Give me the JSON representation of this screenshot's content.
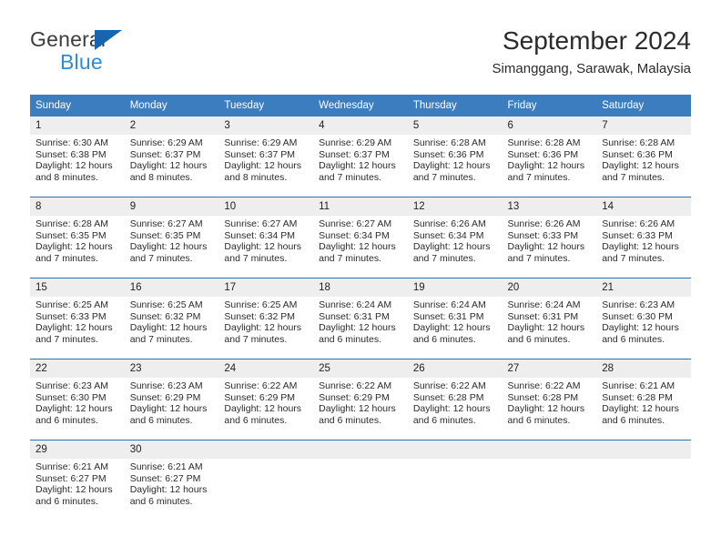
{
  "brand": {
    "name_part1": "General",
    "name_part2": "Blue",
    "triangle_color": "#1565b0",
    "blue_text_color": "#2e8bd8"
  },
  "header": {
    "title": "September 2024",
    "subtitle": "Simanggang, Sarawak, Malaysia"
  },
  "theme": {
    "header_blue": "#3b7dbf",
    "separator_blue": "#2e73ad",
    "daynum_band": "#eeeeee"
  },
  "weekday_headers": [
    "Sunday",
    "Monday",
    "Tuesday",
    "Wednesday",
    "Thursday",
    "Friday",
    "Saturday"
  ],
  "weeks": [
    {
      "days": [
        {
          "num": "1",
          "sunrise": "Sunrise: 6:30 AM",
          "sunset": "Sunset: 6:38 PM",
          "daylight_line1": "Daylight: 12 hours",
          "daylight_line2": "and 8 minutes."
        },
        {
          "num": "2",
          "sunrise": "Sunrise: 6:29 AM",
          "sunset": "Sunset: 6:37 PM",
          "daylight_line1": "Daylight: 12 hours",
          "daylight_line2": "and 8 minutes."
        },
        {
          "num": "3",
          "sunrise": "Sunrise: 6:29 AM",
          "sunset": "Sunset: 6:37 PM",
          "daylight_line1": "Daylight: 12 hours",
          "daylight_line2": "and 8 minutes."
        },
        {
          "num": "4",
          "sunrise": "Sunrise: 6:29 AM",
          "sunset": "Sunset: 6:37 PM",
          "daylight_line1": "Daylight: 12 hours",
          "daylight_line2": "and 7 minutes."
        },
        {
          "num": "5",
          "sunrise": "Sunrise: 6:28 AM",
          "sunset": "Sunset: 6:36 PM",
          "daylight_line1": "Daylight: 12 hours",
          "daylight_line2": "and 7 minutes."
        },
        {
          "num": "6",
          "sunrise": "Sunrise: 6:28 AM",
          "sunset": "Sunset: 6:36 PM",
          "daylight_line1": "Daylight: 12 hours",
          "daylight_line2": "and 7 minutes."
        },
        {
          "num": "7",
          "sunrise": "Sunrise: 6:28 AM",
          "sunset": "Sunset: 6:36 PM",
          "daylight_line1": "Daylight: 12 hours",
          "daylight_line2": "and 7 minutes."
        }
      ]
    },
    {
      "days": [
        {
          "num": "8",
          "sunrise": "Sunrise: 6:28 AM",
          "sunset": "Sunset: 6:35 PM",
          "daylight_line1": "Daylight: 12 hours",
          "daylight_line2": "and 7 minutes."
        },
        {
          "num": "9",
          "sunrise": "Sunrise: 6:27 AM",
          "sunset": "Sunset: 6:35 PM",
          "daylight_line1": "Daylight: 12 hours",
          "daylight_line2": "and 7 minutes."
        },
        {
          "num": "10",
          "sunrise": "Sunrise: 6:27 AM",
          "sunset": "Sunset: 6:34 PM",
          "daylight_line1": "Daylight: 12 hours",
          "daylight_line2": "and 7 minutes."
        },
        {
          "num": "11",
          "sunrise": "Sunrise: 6:27 AM",
          "sunset": "Sunset: 6:34 PM",
          "daylight_line1": "Daylight: 12 hours",
          "daylight_line2": "and 7 minutes."
        },
        {
          "num": "12",
          "sunrise": "Sunrise: 6:26 AM",
          "sunset": "Sunset: 6:34 PM",
          "daylight_line1": "Daylight: 12 hours",
          "daylight_line2": "and 7 minutes."
        },
        {
          "num": "13",
          "sunrise": "Sunrise: 6:26 AM",
          "sunset": "Sunset: 6:33 PM",
          "daylight_line1": "Daylight: 12 hours",
          "daylight_line2": "and 7 minutes."
        },
        {
          "num": "14",
          "sunrise": "Sunrise: 6:26 AM",
          "sunset": "Sunset: 6:33 PM",
          "daylight_line1": "Daylight: 12 hours",
          "daylight_line2": "and 7 minutes."
        }
      ]
    },
    {
      "days": [
        {
          "num": "15",
          "sunrise": "Sunrise: 6:25 AM",
          "sunset": "Sunset: 6:33 PM",
          "daylight_line1": "Daylight: 12 hours",
          "daylight_line2": "and 7 minutes."
        },
        {
          "num": "16",
          "sunrise": "Sunrise: 6:25 AM",
          "sunset": "Sunset: 6:32 PM",
          "daylight_line1": "Daylight: 12 hours",
          "daylight_line2": "and 7 minutes."
        },
        {
          "num": "17",
          "sunrise": "Sunrise: 6:25 AM",
          "sunset": "Sunset: 6:32 PM",
          "daylight_line1": "Daylight: 12 hours",
          "daylight_line2": "and 7 minutes."
        },
        {
          "num": "18",
          "sunrise": "Sunrise: 6:24 AM",
          "sunset": "Sunset: 6:31 PM",
          "daylight_line1": "Daylight: 12 hours",
          "daylight_line2": "and 6 minutes."
        },
        {
          "num": "19",
          "sunrise": "Sunrise: 6:24 AM",
          "sunset": "Sunset: 6:31 PM",
          "daylight_line1": "Daylight: 12 hours",
          "daylight_line2": "and 6 minutes."
        },
        {
          "num": "20",
          "sunrise": "Sunrise: 6:24 AM",
          "sunset": "Sunset: 6:31 PM",
          "daylight_line1": "Daylight: 12 hours",
          "daylight_line2": "and 6 minutes."
        },
        {
          "num": "21",
          "sunrise": "Sunrise: 6:23 AM",
          "sunset": "Sunset: 6:30 PM",
          "daylight_line1": "Daylight: 12 hours",
          "daylight_line2": "and 6 minutes."
        }
      ]
    },
    {
      "days": [
        {
          "num": "22",
          "sunrise": "Sunrise: 6:23 AM",
          "sunset": "Sunset: 6:30 PM",
          "daylight_line1": "Daylight: 12 hours",
          "daylight_line2": "and 6 minutes."
        },
        {
          "num": "23",
          "sunrise": "Sunrise: 6:23 AM",
          "sunset": "Sunset: 6:29 PM",
          "daylight_line1": "Daylight: 12 hours",
          "daylight_line2": "and 6 minutes."
        },
        {
          "num": "24",
          "sunrise": "Sunrise: 6:22 AM",
          "sunset": "Sunset: 6:29 PM",
          "daylight_line1": "Daylight: 12 hours",
          "daylight_line2": "and 6 minutes."
        },
        {
          "num": "25",
          "sunrise": "Sunrise: 6:22 AM",
          "sunset": "Sunset: 6:29 PM",
          "daylight_line1": "Daylight: 12 hours",
          "daylight_line2": "and 6 minutes."
        },
        {
          "num": "26",
          "sunrise": "Sunrise: 6:22 AM",
          "sunset": "Sunset: 6:28 PM",
          "daylight_line1": "Daylight: 12 hours",
          "daylight_line2": "and 6 minutes."
        },
        {
          "num": "27",
          "sunrise": "Sunrise: 6:22 AM",
          "sunset": "Sunset: 6:28 PM",
          "daylight_line1": "Daylight: 12 hours",
          "daylight_line2": "and 6 minutes."
        },
        {
          "num": "28",
          "sunrise": "Sunrise: 6:21 AM",
          "sunset": "Sunset: 6:28 PM",
          "daylight_line1": "Daylight: 12 hours",
          "daylight_line2": "and 6 minutes."
        }
      ]
    },
    {
      "days": [
        {
          "num": "29",
          "sunrise": "Sunrise: 6:21 AM",
          "sunset": "Sunset: 6:27 PM",
          "daylight_line1": "Daylight: 12 hours",
          "daylight_line2": "and 6 minutes."
        },
        {
          "num": "30",
          "sunrise": "Sunrise: 6:21 AM",
          "sunset": "Sunset: 6:27 PM",
          "daylight_line1": "Daylight: 12 hours",
          "daylight_line2": "and 6 minutes."
        },
        {
          "num": "",
          "sunrise": "",
          "sunset": "",
          "daylight_line1": "",
          "daylight_line2": ""
        },
        {
          "num": "",
          "sunrise": "",
          "sunset": "",
          "daylight_line1": "",
          "daylight_line2": ""
        },
        {
          "num": "",
          "sunrise": "",
          "sunset": "",
          "daylight_line1": "",
          "daylight_line2": ""
        },
        {
          "num": "",
          "sunrise": "",
          "sunset": "",
          "daylight_line1": "",
          "daylight_line2": ""
        },
        {
          "num": "",
          "sunrise": "",
          "sunset": "",
          "daylight_line1": "",
          "daylight_line2": ""
        }
      ]
    }
  ]
}
